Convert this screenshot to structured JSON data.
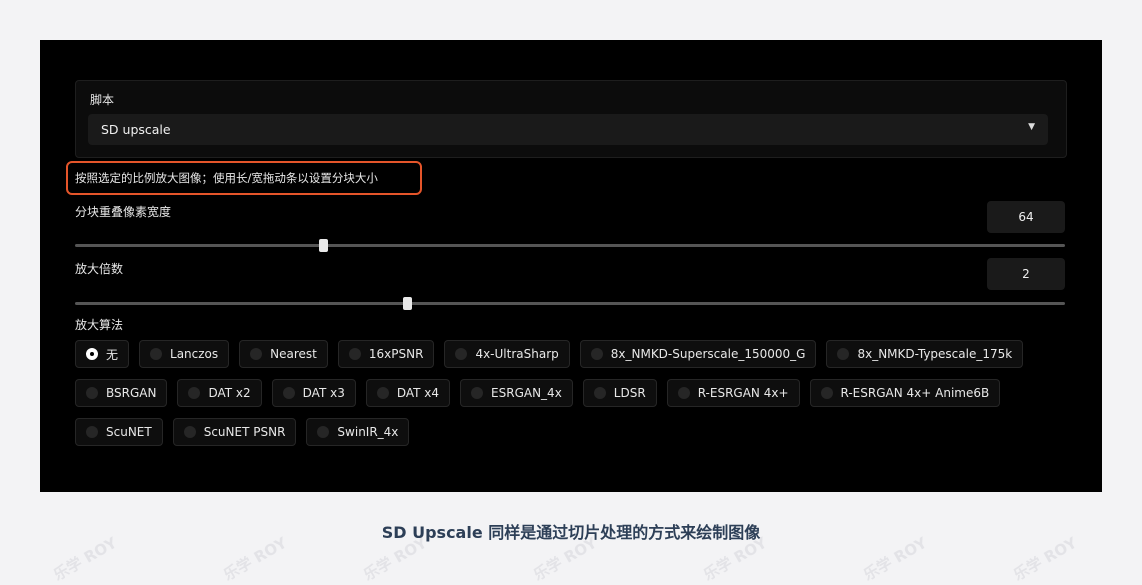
{
  "script": {
    "label": "脚本",
    "value": "SD upscale"
  },
  "description": "按照选定的比例放大图像；使用长/宽拖动条以设置分块大小",
  "overlap": {
    "label": "分块重叠像素宽度",
    "value": "64",
    "fraction": 0.25
  },
  "scale": {
    "label": "放大倍数",
    "value": "2",
    "fraction": 0.335
  },
  "algorithm": {
    "label": "放大算法",
    "rows": [
      [
        "无",
        "Lanczos",
        "Nearest",
        "16xPSNR",
        "4x-UltraSharp",
        "8x_NMKD-Superscale_150000_G",
        "8x_NMKD-Typescale_175k"
      ],
      [
        "BSRGAN",
        "DAT x2",
        "DAT x3",
        "DAT x4",
        "ESRGAN_4x",
        "LDSR",
        "R-ESRGAN 4x+",
        "R-ESRGAN 4x+ Anime6B"
      ],
      [
        "ScuNET",
        "ScuNET PSNR",
        "SwinIR_4x"
      ]
    ],
    "selected": "无"
  },
  "caption": "SD Upscale 同样是通过切片处理的方式来绘制图像",
  "watermark": "乐学 ROY",
  "colors": {
    "highlight": "#e5552a",
    "panel": "#000000",
    "caption": "#2d3f57"
  }
}
